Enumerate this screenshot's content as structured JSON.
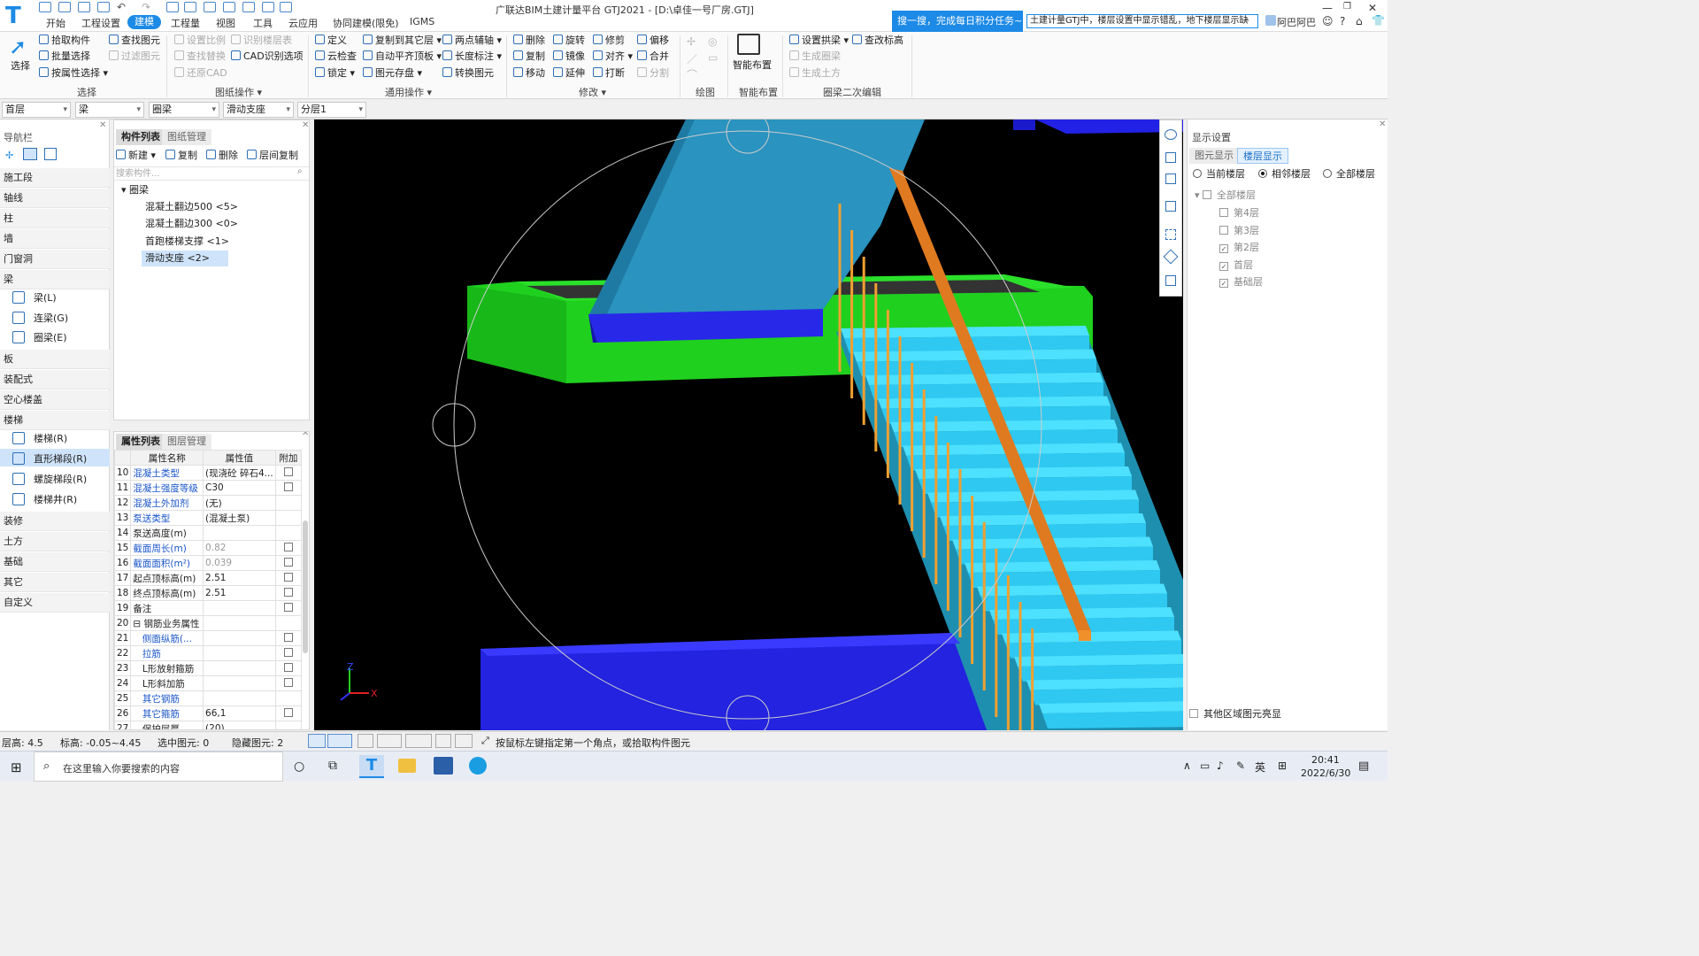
{
  "window": {
    "title": "广联达BIM土建计量平台 GTJ2021 - [D:\\卓佳一号厂房.GTJ]",
    "logo": "T",
    "controls": [
      "☺",
      "?",
      "⌂",
      "👕",
      "—",
      "❐",
      "✕"
    ]
  },
  "menu": {
    "items": [
      "开始",
      "工程设置",
      "建模",
      "工程量",
      "视图",
      "工具",
      "云应用",
      "协同建模(限免)",
      "IGMS"
    ],
    "active": "建模"
  },
  "search": {
    "prompt": "搜一搜，完成每日积分任务~",
    "query": "土建计量GTJ中，楼层设置中显示错乱，地下楼层显示缺",
    "user": "阿巴阿巴"
  },
  "ribbon": {
    "select": {
      "select": "选择",
      "pick": "拾取构件",
      "batch": "批量选择",
      "by_attr": "按属性选择",
      "find": "查找图元",
      "filter": "过滤图元",
      "group": "选择"
    },
    "drawing": {
      "set_scale": "设置比例",
      "find_replace": "查找替换",
      "restore_cad": "还原CAD",
      "recognize_layers": "识别楼层表",
      "cad_options": "CAD识别选项",
      "group": "图纸操作"
    },
    "common": {
      "define": "定义",
      "cloud_check": "云检查",
      "lock": "锁定",
      "copy_to_floor": "复制到其它层",
      "auto_align": "自动平齐顶板",
      "save_element": "图元存盘",
      "two_point_axis": "两点辅轴",
      "length_mark": "长度标注",
      "convert": "转换图元",
      "group": "通用操作"
    },
    "modify": {
      "delete": "删除",
      "copy": "复制",
      "move": "移动",
      "rotate": "旋转",
      "mirror": "镜像",
      "extend": "延伸",
      "trim": "修剪",
      "align": "对齐",
      "break": "打断",
      "offset": "偏移",
      "merge": "合并",
      "split": "分割",
      "group": "修改"
    },
    "draw": {
      "group": "绘图"
    },
    "smart": {
      "label": "智能布置",
      "group": "智能布置"
    },
    "ring_beam_edit": {
      "set_slope": "设置拱梁",
      "gen_ring": "生成圈梁",
      "gen_earth": "生成土方",
      "check_elev": "查改标高",
      "group": "圈梁二次编辑"
    }
  },
  "filters": [
    "首层",
    "梁",
    "圈梁",
    "滑动支座",
    "分层1"
  ],
  "nav": {
    "title": "导航栏",
    "categories": [
      "施工段",
      "轴线",
      "柱",
      "墙",
      "门窗洞",
      "梁",
      "板",
      "装配式",
      "空心楼盖",
      "楼梯",
      "装修",
      "土方",
      "基础",
      "其它",
      "自定义"
    ],
    "beam_items": [
      "梁(L)",
      "连梁(G)",
      "圈梁(E)"
    ],
    "stair_items": [
      "楼梯(R)",
      "直形梯段(R)",
      "螺旋梯段(R)",
      "楼梯井(R)"
    ]
  },
  "component_list": {
    "tabs": [
      "构件列表",
      "图纸管理"
    ],
    "toolbar": {
      "new": "新建",
      "copy": "复制",
      "delete": "删除",
      "floor_copy": "层间复制"
    },
    "search_placeholder": "搜索构件...",
    "root": "圈梁",
    "items": [
      "混凝土翻边500 <5>",
      "混凝土翻边300 <0>",
      "首跑楼梯支撑 <1>",
      "滑动支座 <2>"
    ],
    "selected": "滑动支座 <2>"
  },
  "properties": {
    "tabs": [
      "属性列表",
      "图层管理"
    ],
    "headers": [
      "属性名称",
      "属性值",
      "附加"
    ],
    "rows": [
      {
        "no": "10",
        "name": "混凝土类型",
        "value": "(现浇砼 碎石4...",
        "blue": true,
        "check": true
      },
      {
        "no": "11",
        "name": "混凝土强度等级",
        "value": "C30",
        "blue": true,
        "check": true
      },
      {
        "no": "12",
        "name": "混凝土外加剂",
        "value": "(无)",
        "blue": true,
        "check": false
      },
      {
        "no": "13",
        "name": "泵送类型",
        "value": "(混凝土泵)",
        "blue": true,
        "check": false
      },
      {
        "no": "14",
        "name": "泵送高度(m)",
        "value": "",
        "blue": false,
        "check": false
      },
      {
        "no": "15",
        "name": "截面周长(m)",
        "value": "0.82",
        "blue": true,
        "check": true,
        "gray": true
      },
      {
        "no": "16",
        "name": "截面面积(m²)",
        "value": "0.039",
        "blue": true,
        "check": true,
        "gray": true
      },
      {
        "no": "17",
        "name": "起点顶标高(m)",
        "value": "2.51",
        "blue": false,
        "check": true
      },
      {
        "no": "18",
        "name": "终点顶标高(m)",
        "value": "2.51",
        "blue": false,
        "check": true
      },
      {
        "no": "19",
        "name": "备注",
        "value": "",
        "blue": false,
        "check": true
      },
      {
        "no": "20",
        "name": "⊟ 钢筋业务属性",
        "value": "",
        "blue": false,
        "check": false
      },
      {
        "no": "21",
        "name": "　侧面纵筋(...",
        "value": "",
        "blue": true,
        "check": true
      },
      {
        "no": "22",
        "name": "　拉筋",
        "value": "",
        "blue": true,
        "check": true
      },
      {
        "no": "23",
        "name": "　L形放射箍筋",
        "value": "",
        "blue": false,
        "check": true
      },
      {
        "no": "24",
        "name": "　L形斜加筋",
        "value": "",
        "blue": false,
        "check": true
      },
      {
        "no": "25",
        "name": "　其它钢筋",
        "value": "",
        "blue": true,
        "check": false
      },
      {
        "no": "26",
        "name": "　其它箍筋",
        "value": "66,1",
        "blue": true,
        "check": true
      },
      {
        "no": "27",
        "name": "　保护层厚...",
        "value": "(20)",
        "blue": false,
        "check": false
      }
    ]
  },
  "display_settings": {
    "title": "显示设置",
    "tabs": [
      "图元显示",
      "楼层显示"
    ],
    "radios": [
      "当前楼层",
      "相邻楼层",
      "全部楼层"
    ],
    "radio_selected": "相邻楼层",
    "all_floors": "全部楼层",
    "floors": [
      {
        "name": "第4层",
        "checked": false
      },
      {
        "name": "第3层",
        "checked": false
      },
      {
        "name": "第2层",
        "checked": true
      },
      {
        "name": "首层",
        "checked": true
      },
      {
        "name": "基础层",
        "checked": true
      }
    ],
    "highlight_other": "其他区域图元亮显"
  },
  "viewport": {
    "axis_z": "Z",
    "axis_x": "X",
    "colors": {
      "background": "#000000",
      "upper_flight": "#2a93bf",
      "landing": "#22d322",
      "beam": "#2222e6",
      "stairs": "#33d6ff",
      "handrail": "#e07a20",
      "baluster": "#f0a030"
    }
  },
  "status": {
    "floor_height": "层高:  4.5",
    "elevation": "标高:  -0.05~4.45",
    "selected": "选中图元:  0",
    "hidden": "隐藏图元:  2",
    "hint": "按鼠标左键指定第一个角点，或拾取构件图元"
  },
  "taskbar": {
    "search_placeholder": "在这里输入你要搜索的内容",
    "ime": "英",
    "time": "20:41",
    "date": "2022/6/30"
  }
}
